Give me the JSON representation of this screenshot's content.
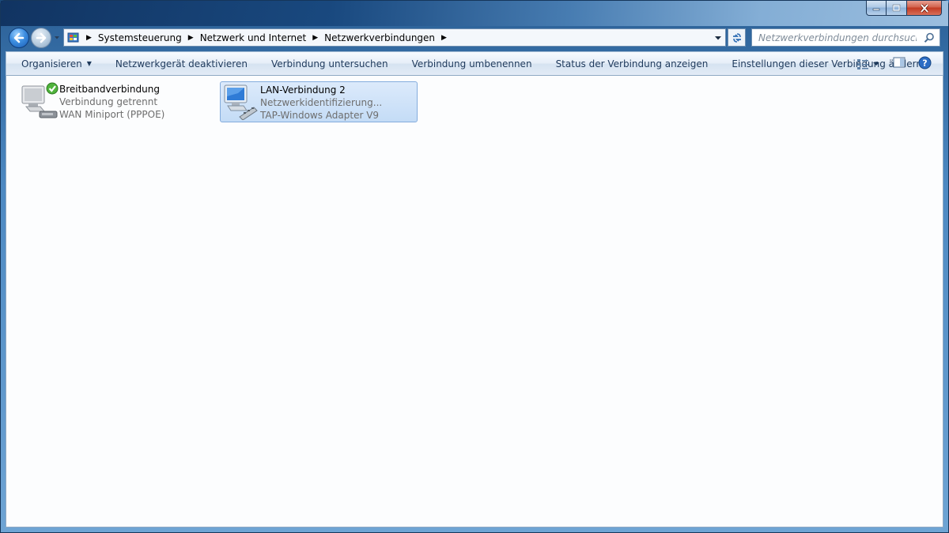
{
  "window": {
    "title": "Netzwerkverbindungen",
    "caption_buttons": {
      "minimize": "minimize-icon",
      "maximize": "maximize-icon",
      "close": "close-icon"
    }
  },
  "navigation": {
    "back_icon": "back-arrow-icon",
    "forward_icon": "forward-arrow-icon",
    "breadcrumbs": [
      {
        "label": "Systemsteuerung"
      },
      {
        "label": "Netzwerk und Internet"
      },
      {
        "label": "Netzwerkverbindungen"
      }
    ],
    "search": {
      "placeholder": "Netzwerkverbindungen durchsuchen",
      "value": ""
    }
  },
  "toolbar": {
    "items": [
      {
        "label": "Organisieren",
        "has_dropdown": true
      },
      {
        "label": "Netzwerkgerät deaktivieren"
      },
      {
        "label": "Verbindung untersuchen"
      },
      {
        "label": "Verbindung umbenennen"
      },
      {
        "label": "Status der Verbindung anzeigen"
      },
      {
        "label": "Einstellungen dieser Verbindung ändern"
      }
    ],
    "icons": {
      "view": "view-options-icon",
      "preview": "preview-pane-icon",
      "help": "help-icon"
    }
  },
  "connections": [
    {
      "name": "Breitbandverbindung",
      "status": "Verbindung getrennt",
      "device": "WAN Miniport (PPPOE)",
      "selected": false,
      "icon": "broadband-connection-icon"
    },
    {
      "name": "LAN-Verbindung 2",
      "status": "Netzwerkidentifizierung...",
      "device": "TAP-Windows Adapter V9",
      "selected": true,
      "icon": "lan-connection-icon"
    }
  ],
  "colors": {
    "selection_bg": "#c4dcf6",
    "selection_border": "#84acdd",
    "toolbar_text": "#1e395b",
    "subtext": "#6d6d6d"
  }
}
